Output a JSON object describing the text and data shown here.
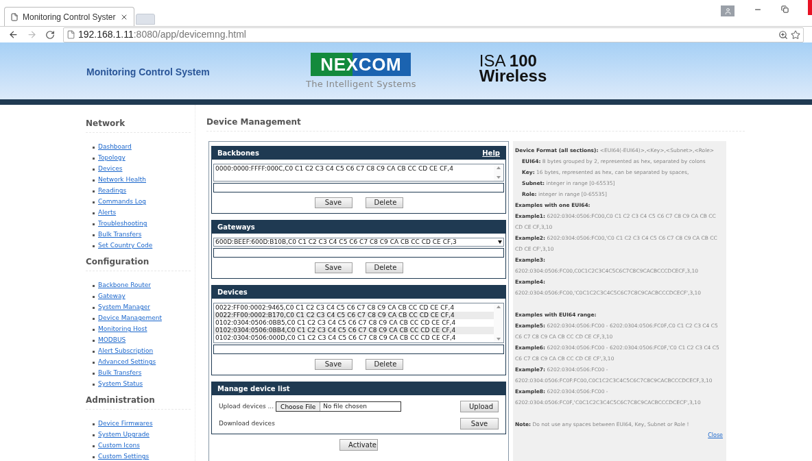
{
  "browser": {
    "tab_title": "Monitoring Control Syster",
    "url_host": "192.168.1.11",
    "url_path": ":8080/app/devicemng.html"
  },
  "header": {
    "title": "Monitoring Control System",
    "logo_text": "NEXCOM",
    "logo_tagline": "The Intelligent Systems",
    "isa_line1": "ISA",
    "isa_number": "100",
    "isa_line2": "Wireless"
  },
  "sidebar": [
    {
      "heading": "Network",
      "items": [
        "Dashboard",
        "Topology",
        "Devices",
        "Network Health",
        "Readings",
        "Commands Log",
        "Alerts",
        "Troubleshooting",
        "Bulk Transfers",
        "Set Country Code"
      ]
    },
    {
      "heading": "Configuration",
      "items": [
        "Backbone Router",
        "Gateway",
        "System Manager",
        "Device Management",
        "Monitoring Host",
        "MODBUS",
        "Alert Subscription",
        "Advanced Settings",
        "Bulk Transfers",
        "System Status"
      ]
    },
    {
      "heading": "Administration",
      "items": [
        "Device Firmwares",
        "System Upgrade",
        "Custom Icons",
        "Custom Settings"
      ]
    }
  ],
  "page_title": "Device Management",
  "sections": [
    {
      "kind": "list",
      "title": "Backbones",
      "help_link": "Help",
      "rows": [
        {
          "text": "0000:0000:FFFF:000C,C0 C1 C2 C3 C4 C5 C6 C7 C8 C9 CA CB CC CD CE CF,4",
          "selected": false
        }
      ],
      "buttons": [
        "Save",
        "Delete"
      ]
    },
    {
      "kind": "dropdown",
      "title": "Gateways",
      "value": "600D:BEEF:600D:B10B,C0 C1 C2 C3 C4 C5 C6 C7 C8 C9 CA CB CC CD CE CF,3",
      "buttons": [
        "Save",
        "Delete"
      ]
    },
    {
      "kind": "list",
      "title": "Devices",
      "rows": [
        {
          "text": "0022:FF00:0002:9465,C0 C1 C2 C3 C4 C5 C6 C7 C8 C9 CA CB CC CD CE CF,4",
          "selected": false
        },
        {
          "text": "0022:FF00:0002:B170,C0 C1 C2 C3 C4 C5 C6 C7 C8 C9 CA CB CC CD CE CF,4",
          "selected": true
        },
        {
          "text": "0102:0304:0506:0BB5,C0 C1 C2 C3 C4 C5 C6 C7 C8 C9 CA CB CC CD CE CF,4",
          "selected": false
        },
        {
          "text": "0102:0304:0506:0BB4,C0 C1 C2 C3 C4 C5 C6 C7 C8 C9 CA CB CC CD CE CF,4",
          "selected": true
        },
        {
          "text": "0102:0304:0506:000D,C0 C1 C2 C3 C4 C5 C6 C7 C8 C9 CA CB CC CD CE CF,4",
          "selected": false
        }
      ],
      "buttons": [
        "Save",
        "Delete"
      ]
    },
    {
      "kind": "manage",
      "title": "Manage device list",
      "upload_label": "Upload devices ...",
      "choose_file": "Choose File",
      "file_status": "No file chosen",
      "upload_button": "Upload",
      "download_label": "Download devices",
      "download_button": "Save"
    }
  ],
  "activate_button": "Activate",
  "help": {
    "lines": [
      {
        "text": "**Device Format (all sections):** <EUI64(-EUI64)>,<Key>,<Subnet>,<Role>",
        "indent": false
      },
      {
        "text": "**EUI64:** 8 bytes grouped by 2, represented as hex, separated by colons",
        "indent": true
      },
      {
        "text": "**Key:** 16 bytes, represented as hex, can be separated by spaces,",
        "indent": true
      },
      {
        "text": "**Subnet:** integer in range [0-65535]",
        "indent": true
      },
      {
        "text": "**Role:** integer in range [0-65535]",
        "indent": true
      },
      {
        "text": "**Examples with one EUI64:**",
        "indent": false
      },
      {
        "text": "**Example1:** 6202:0304:0506:FC00,C0 C1 C2 C3 C4 C5 C6 C7 C8 C9 CA CB CC CD CE CF,3,10",
        "indent": false
      },
      {
        "text": "**Example2:** 6202:0304:0506:FC00,'C0 C1 C2 C3 C4 C5 C6 C7 C8 C9 CA CB CC CD CE CF',3,10",
        "indent": false
      },
      {
        "text": "**Example3:**",
        "indent": false
      },
      {
        "text": "6202:0304:0506:FC00,C0C1C2C3C4C5C6C7C8C9CACBCCCDCECF,3,10",
        "indent": false
      },
      {
        "text": "**Example4:**",
        "indent": false
      },
      {
        "text": "6202:0304:0506:FC00,'C0C1C2C3C4C5C6C7C8C9CACBCCCDCECF',3,10",
        "indent": false
      },
      {
        "text": "**Examples with EUI64 range:**",
        "indent": false,
        "gap": true
      },
      {
        "text": "**Example5:** 6202:0304:0506:FC00 - 6202:0304:0506:FC0F,C0 C1 C2 C3 C4 C5 C6 C7 C8 C9 CA CB CC CD CE CF,3,10",
        "indent": false
      },
      {
        "text": "**Example6:** 6202:0304:0506:FC00 - 6202:0304:0506:FC0F,'C0 C1 C2 C3 C4 C5 C6 C7 C8 C9 CA CB CC CD CE CF',3,10",
        "indent": false
      },
      {
        "text": "**Example7:** 6202:0304:0506:FC00 -",
        "indent": false
      },
      {
        "text": "6202:0304:0506:FC0F:FC00,C0C1C2C3C4C5C6C7C8C9CACBCCCDCECF,3,10",
        "indent": false
      },
      {
        "text": "**Example8:** 6202:0304:0506:FC00 -",
        "indent": false
      },
      {
        "text": "6202:0304:0506:FC0F,'C0C1C2C3C4C5C6C7C8C9CACBCCCDCECF',3,10",
        "indent": false
      },
      {
        "text": "**Note:** Do not use any spaces between EUI64, Key, Subnet or Role !",
        "indent": false,
        "gap": true
      }
    ],
    "close_link": "Close"
  }
}
